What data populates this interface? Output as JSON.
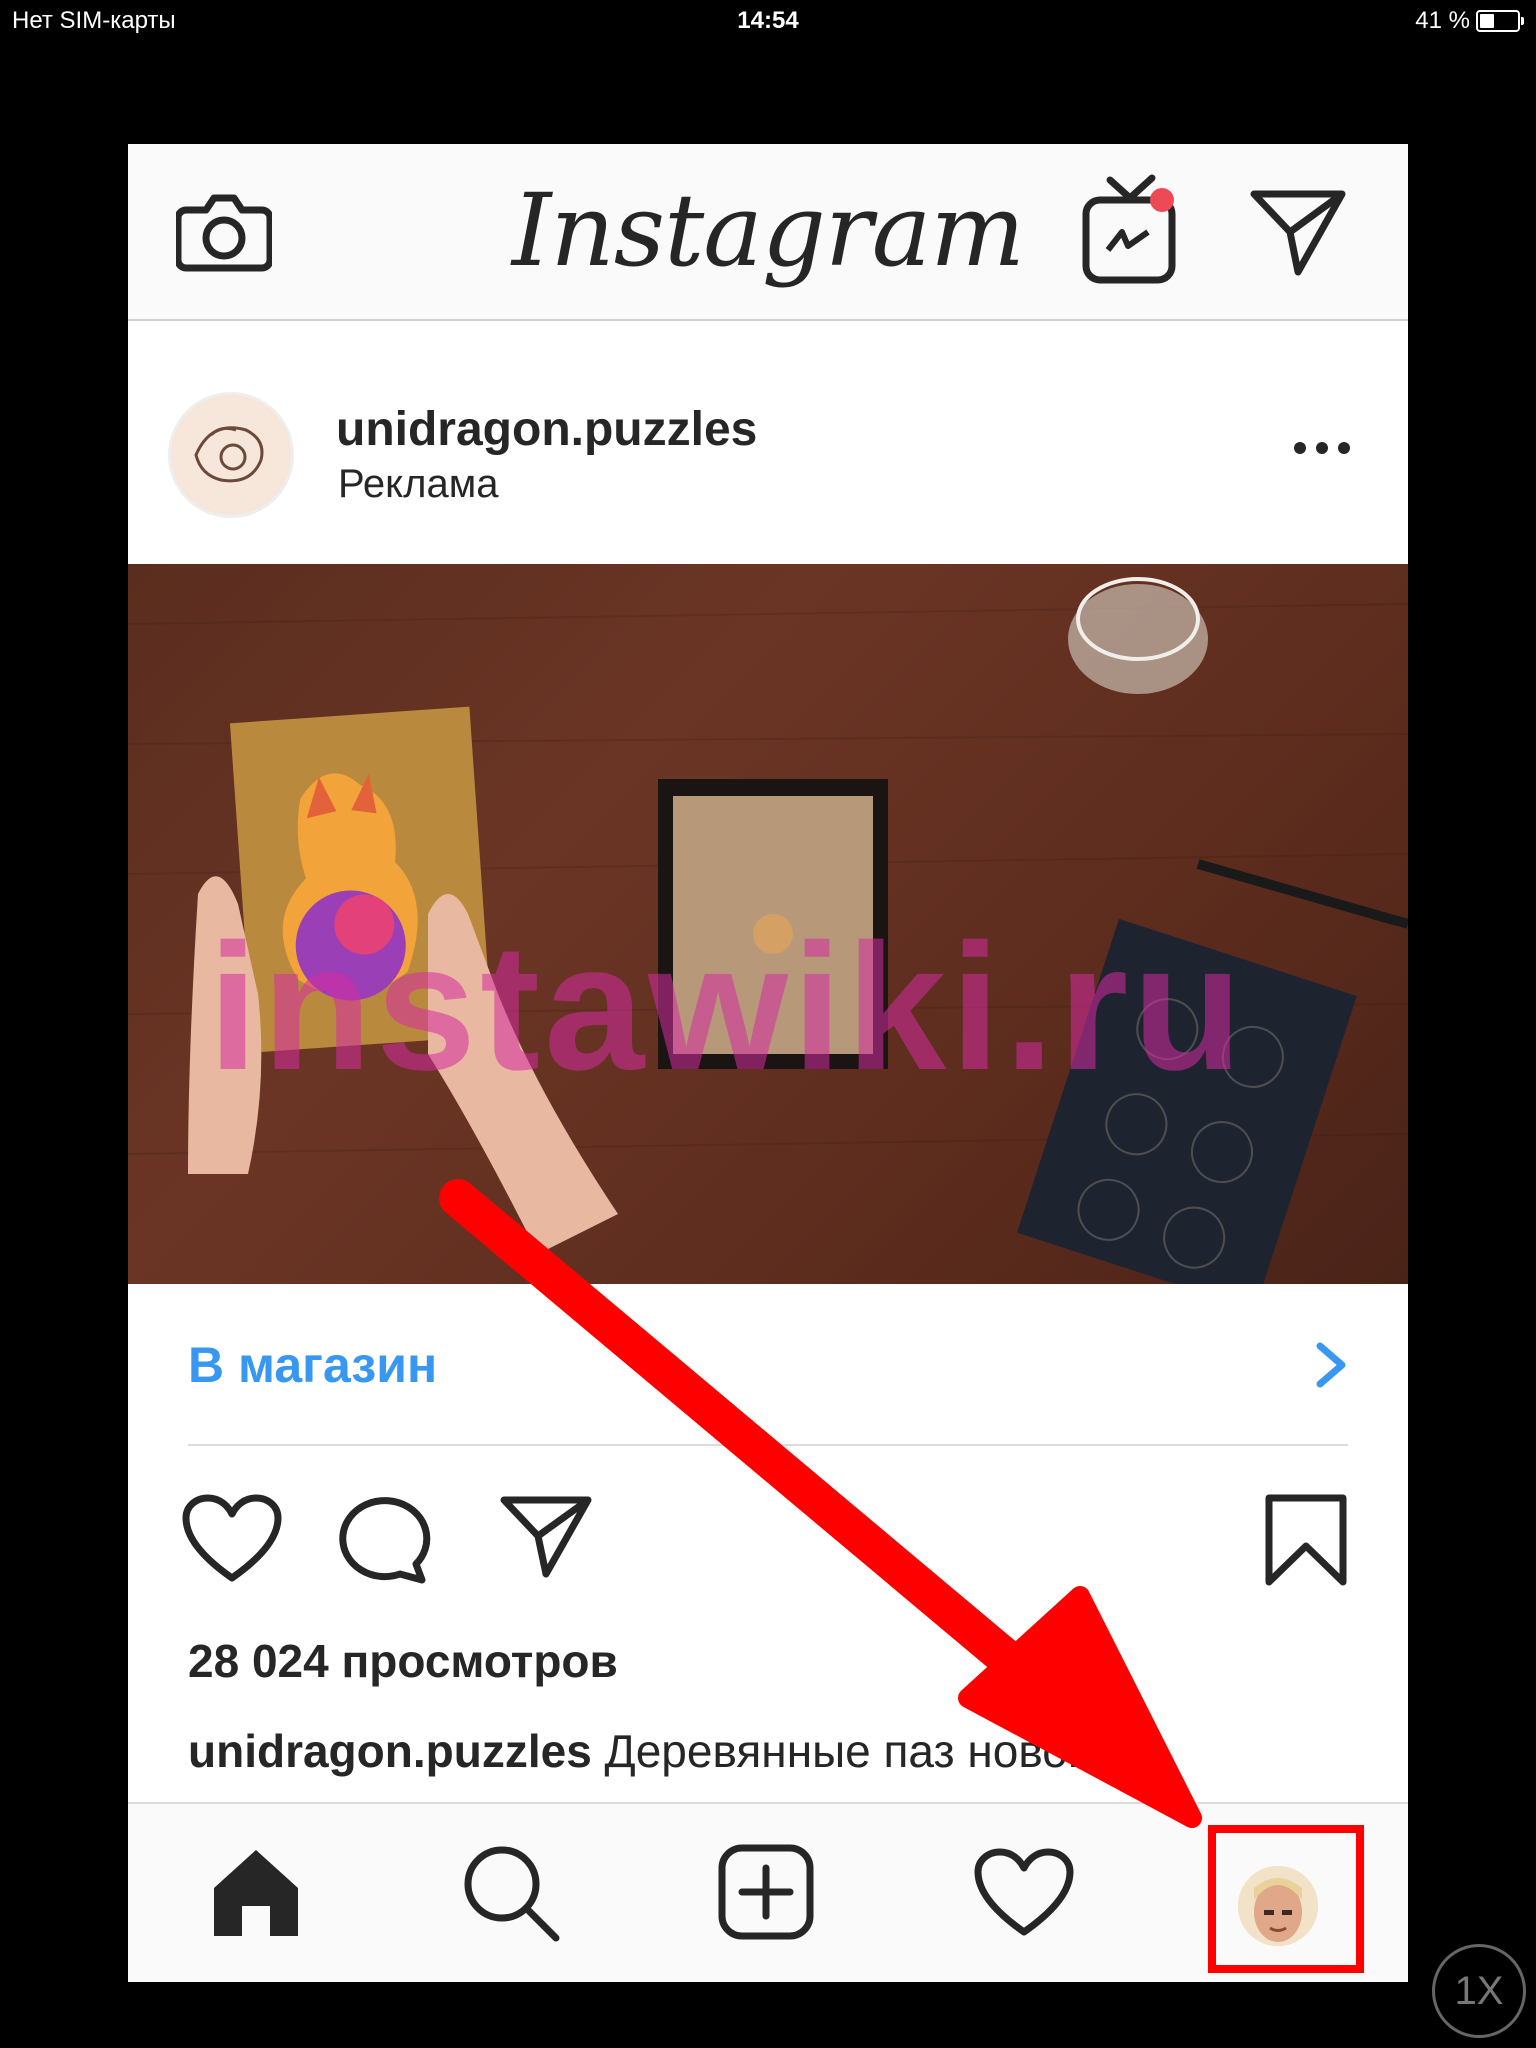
{
  "status_bar": {
    "carrier": "Нет SIM-карты",
    "time": "14:54",
    "battery": "41 %",
    "battery_level": 0.41
  },
  "header": {
    "logo": "Instagram",
    "icons": [
      "camera-icon",
      "igtv-icon",
      "direct-icon"
    ],
    "notification_color": "#ed4956"
  },
  "post": {
    "username": "unidragon.puzzles",
    "sponsored_label": "Реклама",
    "watermark": "instawiki.ru",
    "cta_label": "В магазин",
    "cta_color": "#3897f0",
    "views": "28 024 просмотров",
    "caption_user": "unidragon.puzzles",
    "caption_text": " Деревянные паз   нового"
  },
  "tabbar": {
    "items": [
      "home-icon",
      "search-icon",
      "new-post-icon",
      "activity-icon",
      "profile-avatar"
    ]
  },
  "annotation": {
    "color": "#ff0000",
    "speed_label": "1X"
  }
}
